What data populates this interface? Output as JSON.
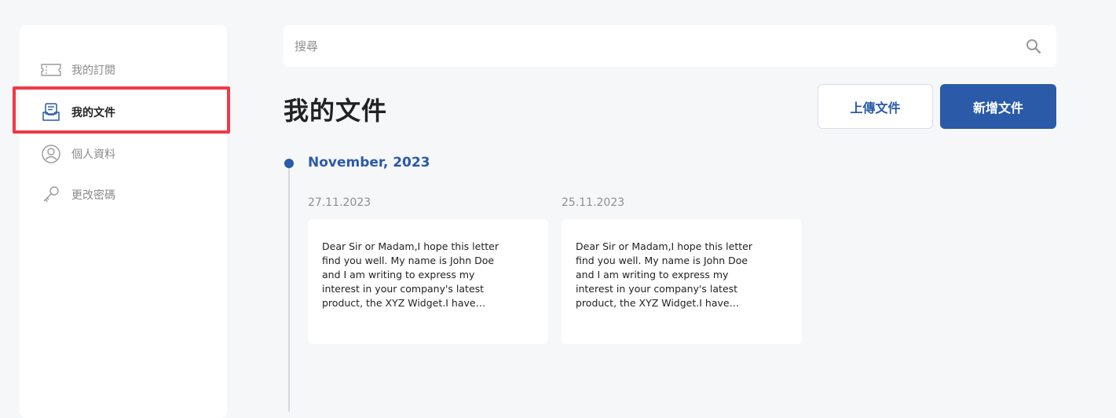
{
  "sidebar": {
    "items": [
      {
        "label": "我的訂閱",
        "icon": "ticket-icon"
      },
      {
        "label": "我的文件",
        "icon": "document-tray-icon",
        "active": true
      },
      {
        "label": "個人資料",
        "icon": "user-circle-icon"
      },
      {
        "label": "更改密碼",
        "icon": "key-icon"
      }
    ]
  },
  "search": {
    "placeholder": "搜尋",
    "icon": "search-icon"
  },
  "header": {
    "title": "我的文件",
    "upload_label": "上傳文件",
    "new_label": "新增文件"
  },
  "timeline": {
    "month": "November, 2023",
    "documents": [
      {
        "date": "27.11.2023",
        "excerpt": "Dear Sir or Madam,I hope this letter find you well. My name is John Doe and I am writing to express my interest in your company's latest product, the XYZ Widget.I have…"
      },
      {
        "date": "25.11.2023",
        "excerpt": "Dear Sir or Madam,I hope this letter find you well. My name is John Doe and I am writing to express my interest in your company's latest product, the XYZ Widget.I have…"
      }
    ]
  },
  "colors": {
    "accent": "#2a5aa8",
    "highlight": "#f0384a",
    "background": "#f6f7f9"
  }
}
